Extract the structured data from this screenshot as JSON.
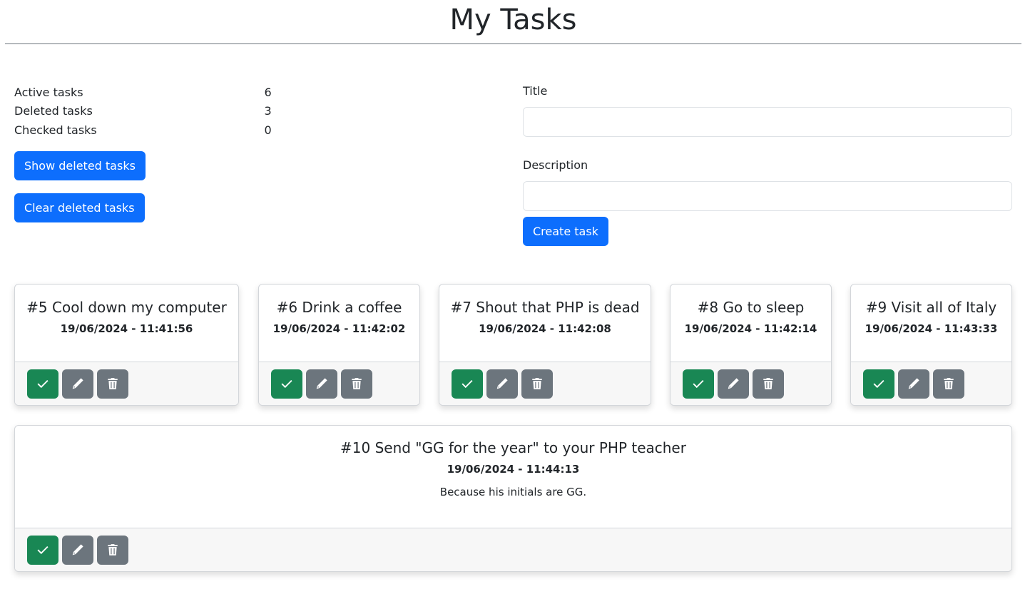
{
  "page": {
    "title": "My Tasks"
  },
  "stats": [
    {
      "label": "Active tasks",
      "value": "6"
    },
    {
      "label": "Deleted tasks",
      "value": "3"
    },
    {
      "label": "Checked tasks",
      "value": "0"
    }
  ],
  "buttons": {
    "show_deleted": "Show deleted tasks",
    "clear_deleted": "Clear deleted tasks",
    "create": "Create task"
  },
  "form": {
    "title_label": "Title",
    "title_value": "",
    "description_label": "Description",
    "description_value": ""
  },
  "tasks": [
    {
      "title": "#5 Cool down my computer",
      "date": "19/06/2024 - 11:41:56",
      "description": ""
    },
    {
      "title": "#6 Drink a coffee",
      "date": "19/06/2024 - 11:42:02",
      "description": ""
    },
    {
      "title": "#7 Shout that PHP is dead",
      "date": "19/06/2024 - 11:42:08",
      "description": ""
    },
    {
      "title": "#8 Go to sleep",
      "date": "19/06/2024 - 11:42:14",
      "description": ""
    },
    {
      "title": "#9 Visit all of Italy",
      "date": "19/06/2024 - 11:43:33",
      "description": ""
    },
    {
      "title": "#10 Send \"GG for the year\" to your PHP teacher",
      "date": "19/06/2024 - 11:44:13",
      "description": "Because his initials are GG."
    }
  ],
  "icons": {
    "check": "check-icon",
    "edit": "pencil-icon",
    "delete": "trash-icon"
  },
  "colors": {
    "primary": "#0d6efd",
    "success": "#198754",
    "secondary": "#6c757d"
  }
}
